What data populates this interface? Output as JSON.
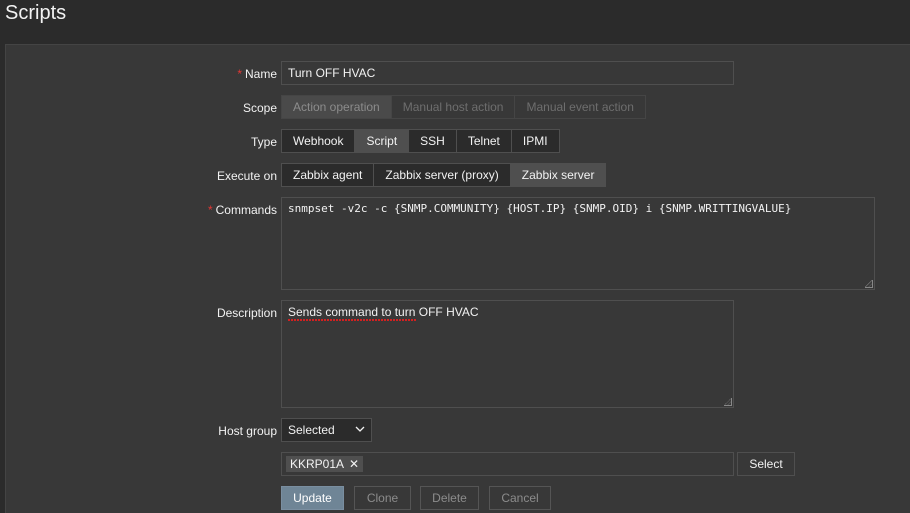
{
  "header": {
    "title": "Scripts"
  },
  "form": {
    "name": {
      "label": "Name",
      "value": "Turn OFF HVAC",
      "required": true
    },
    "scope": {
      "label": "Scope",
      "options": [
        "Action operation",
        "Manual host action",
        "Manual event action"
      ],
      "selected": "Action operation",
      "disabled": true
    },
    "type": {
      "label": "Type",
      "options": [
        "Webhook",
        "Script",
        "SSH",
        "Telnet",
        "IPMI"
      ],
      "selected": "Script"
    },
    "execute_on": {
      "label": "Execute on",
      "options": [
        "Zabbix agent",
        "Zabbix server (proxy)",
        "Zabbix server"
      ],
      "selected": "Zabbix server"
    },
    "commands": {
      "label": "Commands",
      "value": "snmpset -v2c -c {SNMP.COMMUNITY} {HOST.IP} {SNMP.OID} i {SNMP.WRITTINGVALUE}",
      "required": true
    },
    "description": {
      "label": "Description",
      "value": "Sends command to turn OFF HVAC"
    },
    "host_group": {
      "label": "Host group",
      "select_value": "Selected",
      "tags": [
        "KKRP01A"
      ],
      "select_button": "Select"
    }
  },
  "buttons": {
    "update": "Update",
    "clone": "Clone",
    "delete": "Delete",
    "cancel": "Cancel"
  },
  "colors": {
    "background": "#2b2b2b",
    "panel": "#383838",
    "required": "#e33734",
    "primary": "#6f8596"
  }
}
